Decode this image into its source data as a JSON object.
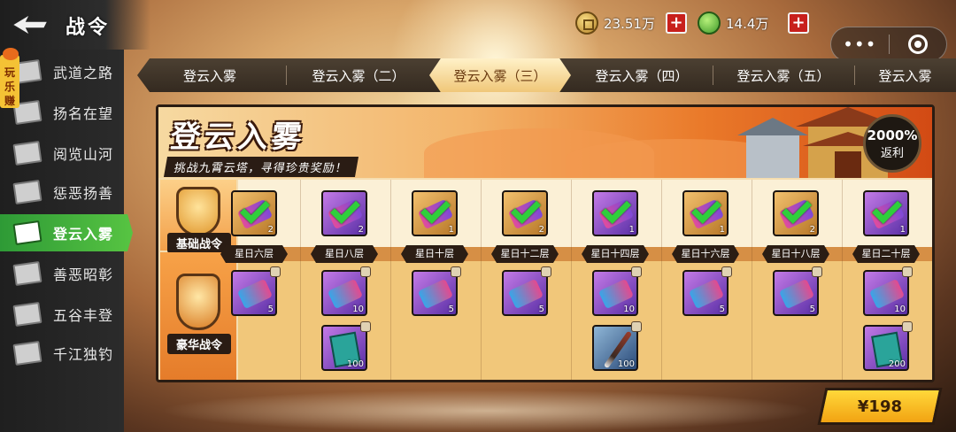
{
  "header": {
    "title": "战令"
  },
  "resources": [
    {
      "icon": "coin-icon",
      "value": "23.51万"
    },
    {
      "icon": "jade-icon",
      "value": "14.4万"
    }
  ],
  "capsule": {
    "more": "•••"
  },
  "promo": {
    "label": "玩乐赚"
  },
  "sidebar": {
    "items": [
      {
        "label": "武道之路",
        "active": false
      },
      {
        "label": "扬名在望",
        "active": false
      },
      {
        "label": "阅览山河",
        "active": false
      },
      {
        "label": "惩恶扬善",
        "active": false
      },
      {
        "label": "登云入雾",
        "active": true
      },
      {
        "label": "善恶昭彰",
        "active": false
      },
      {
        "label": "五谷丰登",
        "active": false
      },
      {
        "label": "千江独钓",
        "active": false
      }
    ]
  },
  "tabs": [
    {
      "label": "登云入雾",
      "active": false
    },
    {
      "label": "登云入雾（二）",
      "active": false
    },
    {
      "label": "登云入雾（三）",
      "active": true
    },
    {
      "label": "登云入雾（四）",
      "active": false
    },
    {
      "label": "登云入雾（五）",
      "active": false
    },
    {
      "label": "登云入雾",
      "active": false
    }
  ],
  "banner": {
    "title": "登云入雾",
    "subtitle": "挑战九霄云塔，寻得珍贵奖励！",
    "rebate_value": "2000%",
    "rebate_label": "返利"
  },
  "lanes": {
    "basic": "基础战令",
    "premium": "豪华战令"
  },
  "stages": [
    "星日六层",
    "星日八层",
    "星日十层",
    "星日十二层",
    "星日十四层",
    "星日十六层",
    "星日十八层",
    "星日二十层"
  ],
  "basic_rewards": [
    {
      "type": "orange",
      "count": "2",
      "claimed": true
    },
    {
      "type": "purple",
      "count": "2",
      "claimed": true
    },
    {
      "type": "orange",
      "count": "1",
      "claimed": true
    },
    {
      "type": "orange",
      "count": "2",
      "claimed": true
    },
    {
      "type": "purple",
      "count": "1",
      "claimed": true
    },
    {
      "type": "orange",
      "count": "1",
      "claimed": true
    },
    {
      "type": "orange",
      "count": "2",
      "claimed": true
    },
    {
      "type": "purple",
      "count": "1",
      "claimed": true
    }
  ],
  "premium_rewards_top": [
    {
      "count": "5"
    },
    {
      "count": "10"
    },
    {
      "count": "5"
    },
    {
      "count": "5"
    },
    {
      "count": "10"
    },
    {
      "count": "5"
    },
    {
      "count": "5"
    },
    {
      "count": "10"
    }
  ],
  "premium_rewards_bottom": [
    {
      "col": 1,
      "kind": "book",
      "count": "100"
    },
    {
      "col": 4,
      "kind": "brush",
      "count": "100"
    },
    {
      "col": 7,
      "kind": "book",
      "count": "200"
    }
  ],
  "purchase": {
    "price": "¥198"
  },
  "colors": {
    "accent_green": "#57c442",
    "gold": "#ffd83a",
    "check": "#2fcf3b"
  }
}
